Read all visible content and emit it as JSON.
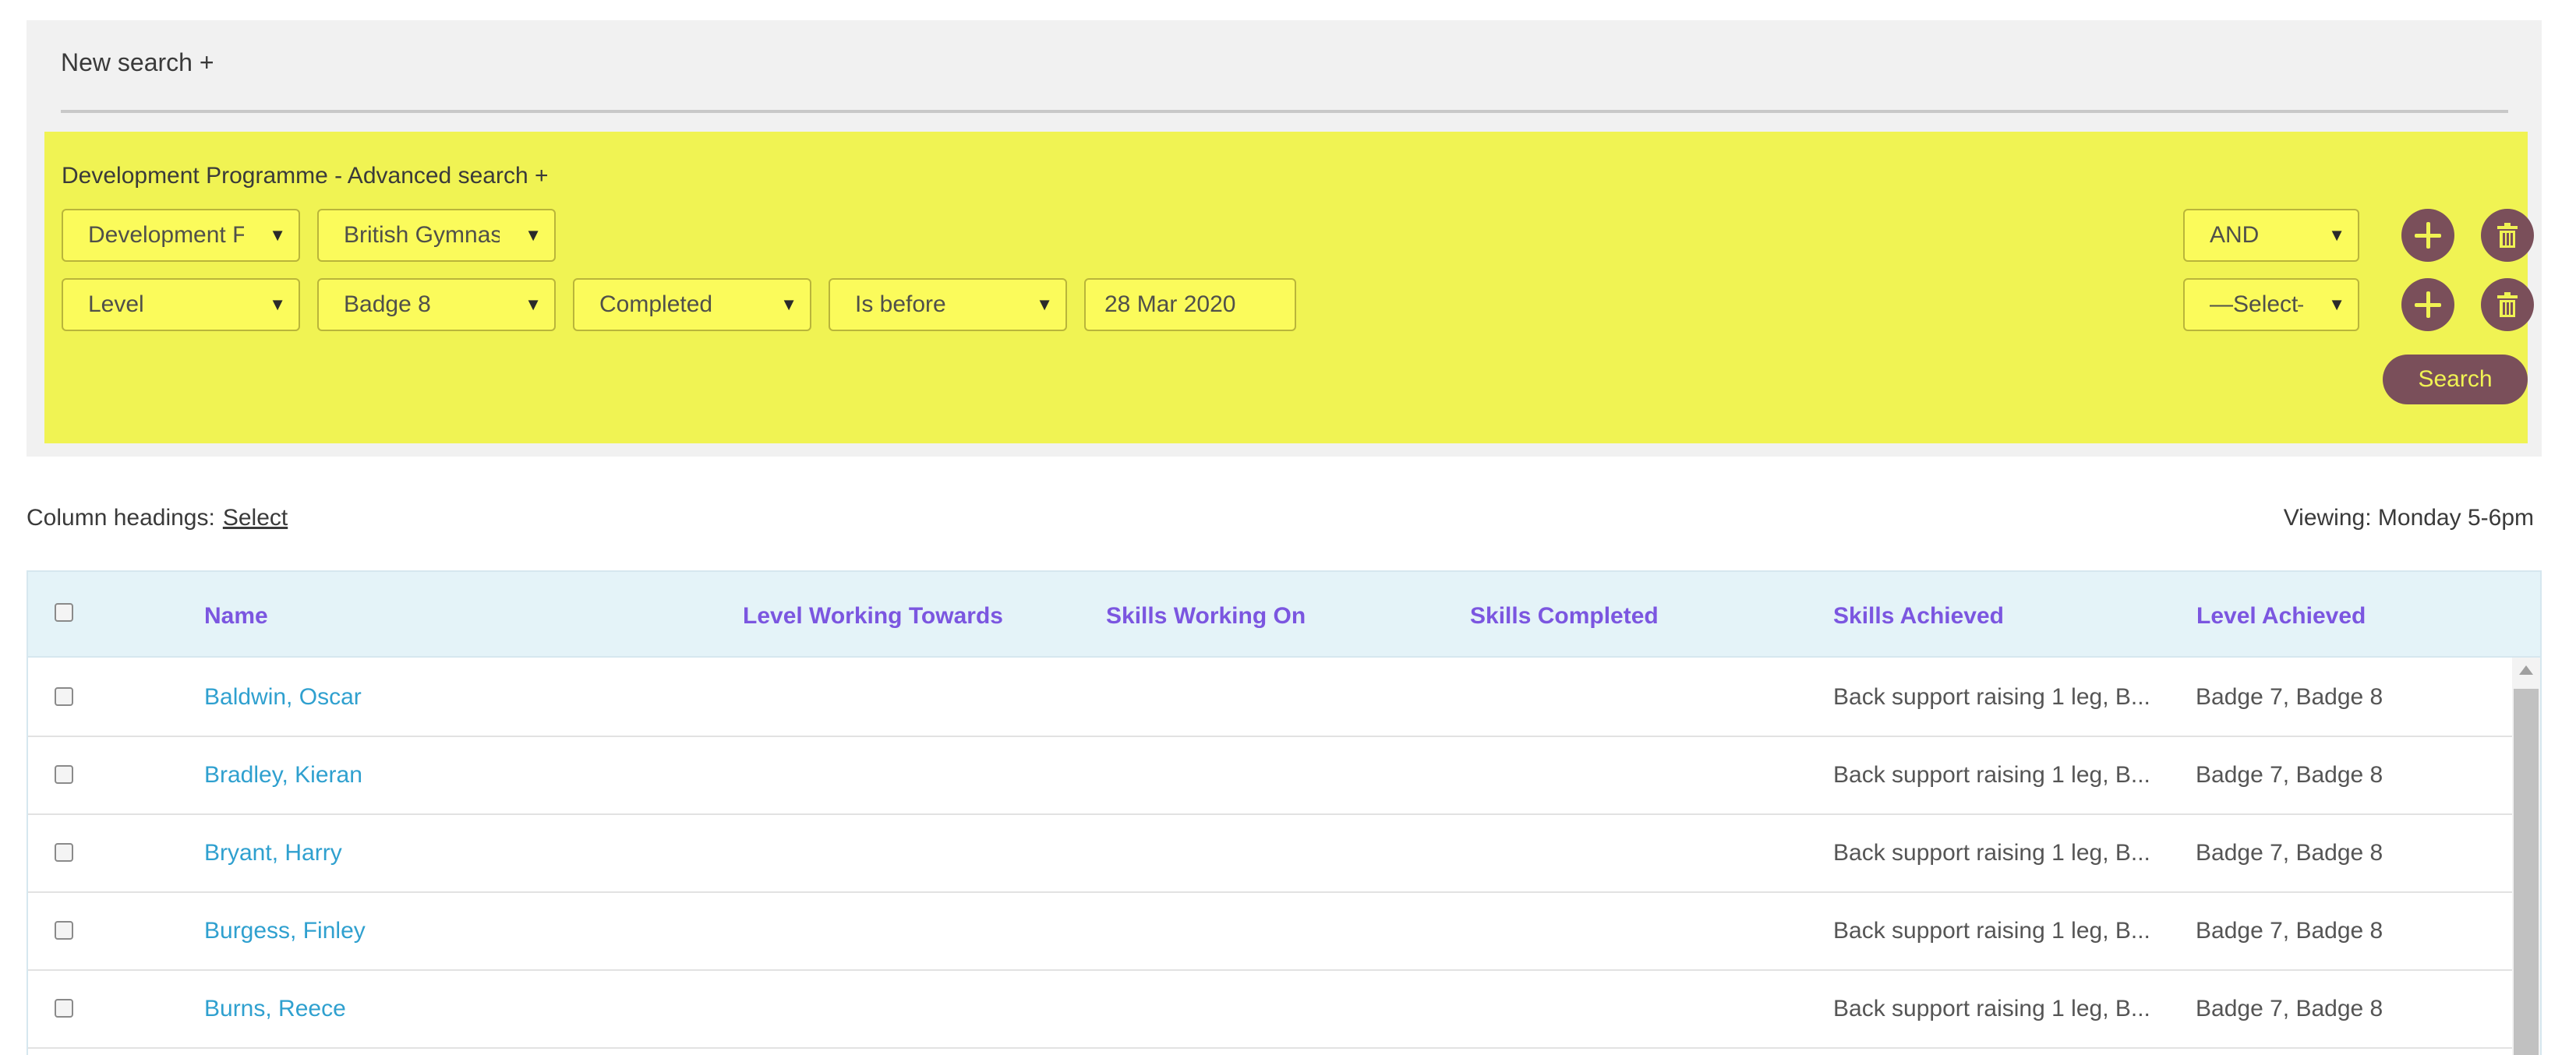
{
  "search": {
    "new_search_label": "New search +",
    "advanced_title": "Development Programme - Advanced search +",
    "row1": {
      "field1": "Development F",
      "field2": "British Gymnas",
      "logic": "AND"
    },
    "row2": {
      "field1": "Level",
      "field2": "Badge 8",
      "field3": "Completed",
      "field4": "Is before",
      "date": "28 Mar 2020",
      "logic": "—Select—"
    },
    "search_button": "Search"
  },
  "toolbar": {
    "column_headings_label": "Column headings:",
    "select_link": "Select",
    "viewing_label": "Viewing: Monday 5-6pm"
  },
  "table": {
    "headers": {
      "name": "Name",
      "level_working_towards": "Level Working Towards",
      "skills_working_on": "Skills Working On",
      "skills_completed": "Skills Completed",
      "skills_achieved": "Skills Achieved",
      "level_achieved": "Level Achieved"
    },
    "rows": [
      {
        "name": "Baldwin, Oscar",
        "skills_achieved": "Back support raising 1 leg, B...",
        "level_achieved": "Badge 7, Badge 8"
      },
      {
        "name": "Bradley, Kieran",
        "skills_achieved": "Back support raising 1 leg, B...",
        "level_achieved": "Badge 7, Badge 8"
      },
      {
        "name": "Bryant, Harry",
        "skills_achieved": "Back support raising 1 leg, B...",
        "level_achieved": "Badge 7, Badge 8"
      },
      {
        "name": "Burgess, Finley",
        "skills_achieved": "Back support raising 1 leg, B...",
        "level_achieved": "Badge 7, Badge 8"
      },
      {
        "name": "Burns, Reece",
        "skills_achieved": "Back support raising 1 leg, B...",
        "level_achieved": "Badge 7, Badge 8"
      }
    ]
  },
  "colors": {
    "highlight_yellow": "#f0f353",
    "button_plum": "#7a4f5a",
    "header_text_purple": "#7b56e0",
    "link_blue": "#2fa0cf",
    "table_header_bg": "#e4f3f8"
  },
  "icons": {
    "add": "plus-icon",
    "delete": "trash-icon",
    "dropdown": "caret-down-icon"
  }
}
